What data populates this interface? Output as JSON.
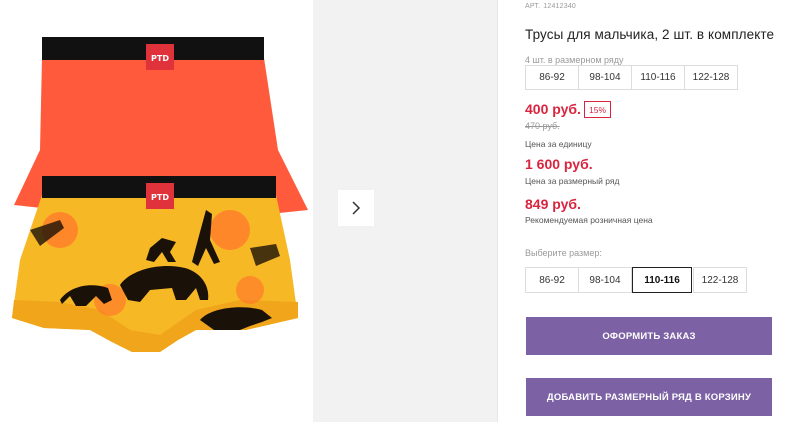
{
  "product": {
    "sku_label": "АРТ.",
    "sku_value": "12412340",
    "title": "Трусы для мальчика, 2 шт. в комплекте"
  },
  "size_row": {
    "label": "4 шт. в размерном ряду",
    "sizes": [
      "86-92",
      "98-104",
      "110-116",
      "122-128"
    ]
  },
  "pricing": {
    "price": "400 руб.",
    "discount": "15%",
    "old_price": "470 руб.",
    "unit_note": "Цена за единицу",
    "row_price": "1 600 руб.",
    "row_note": "Цена за размерный ряд",
    "rrp": "849 руб.",
    "rrp_note": "Рекомендуемая розничная цена"
  },
  "size_select": {
    "label": "Выберите размер:",
    "options": [
      "86-92",
      "98-104",
      "110-116",
      "122-128"
    ],
    "selected": "110-116"
  },
  "actions": {
    "order": "ОФОРМИТЬ ЗАКАЗ",
    "add_row": "ДОБАВИТЬ РАЗМЕРНЫЙ РЯД В КОРЗИНУ"
  },
  "image": {
    "brand_tag": "PTD",
    "colors": {
      "orange": "#ff5a3c",
      "yellow": "#f7b825",
      "band": "#111111",
      "tag": "#e0323b",
      "button": "#7c61a4",
      "price": "#d9243f"
    }
  }
}
